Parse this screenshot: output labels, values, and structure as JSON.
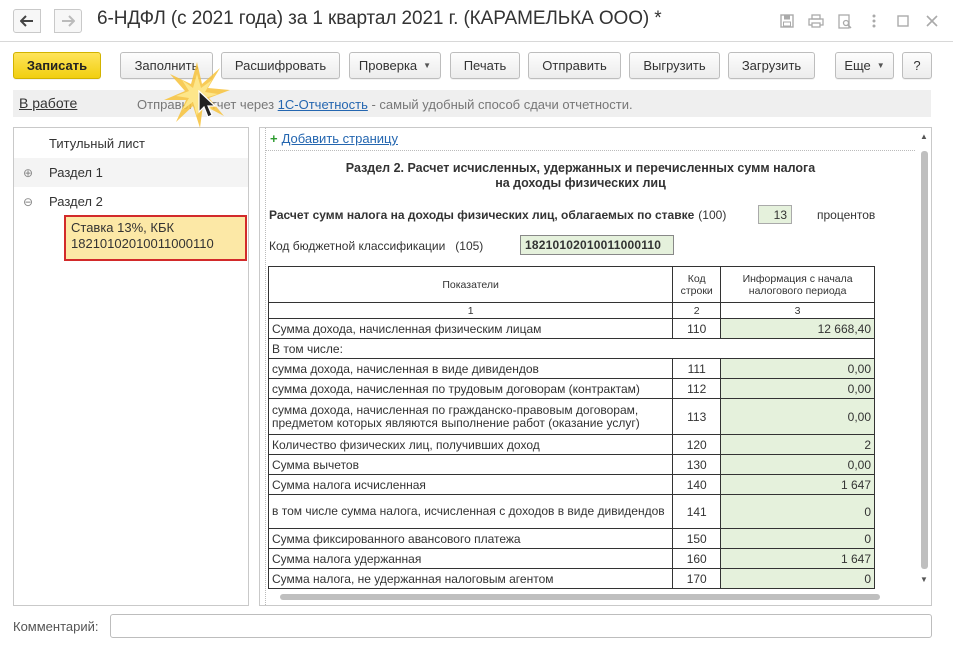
{
  "window": {
    "title": "6-НДФЛ (с 2021 года) за 1 квартал 2021 г. (КАРАМЕЛЬКА ООО) *",
    "icons": [
      "back-arrow-icon",
      "forward-arrow-icon",
      "save-disk-icon",
      "print-icon",
      "preview-icon",
      "more-vertical-icon",
      "maximize-icon",
      "close-icon"
    ]
  },
  "toolbar": {
    "save": "Записать",
    "fill": "Заполнить",
    "decode": "Расшифровать",
    "check": "Проверка",
    "print": "Печать",
    "send": "Отправить",
    "export": "Выгрузить",
    "import": "Загрузить",
    "more": "Еще",
    "help": "?"
  },
  "status": {
    "state_link": "В работе",
    "info_prefix": "Отправьте отчет через ",
    "info_link": "1С-Отчетность",
    "info_suffix": " - самый удобный способ сдачи отчетности."
  },
  "tree": {
    "items": [
      {
        "label": "Титульный лист",
        "toggle": ""
      },
      {
        "label": "Раздел 1",
        "toggle": "⊕"
      },
      {
        "label": "Раздел 2",
        "toggle": "⊖"
      }
    ],
    "selected_line1": "Ставка 13%, КБК",
    "selected_line2": "18210102010011000110"
  },
  "form": {
    "add_page": "Добавить страницу",
    "section_title_line1": "Раздел 2. Расчет исчисленных, удержанных и перечисленных сумм налога",
    "section_title_line2": "на доходы физических лиц",
    "rate_label": "Расчет сумм налога на доходы физических лиц, облагаемых по ставке",
    "rate_code": "(100)",
    "rate_value": "13",
    "rate_unit": "процентов",
    "kbk_label": "Код бюджетной классификации   (105)",
    "kbk_value": "18210102010011000110",
    "table": {
      "headers": [
        "Показатели",
        "Код\nстроки",
        "Информация с начала\nналогового периода"
      ],
      "col_numbers": [
        "1",
        "2",
        "3"
      ],
      "rows": [
        {
          "label": "Сумма дохода, начисленная физическим лицам",
          "code": "110",
          "value": "12 668,40"
        },
        {
          "label": "В том числе:",
          "code": "",
          "value": ""
        },
        {
          "label": "сумма дохода, начисленная в виде дивидендов",
          "code": "111",
          "value": "0,00"
        },
        {
          "label": "сумма дохода, начисленная по трудовым договорам (контрактам)",
          "code": "112",
          "value": "0,00"
        },
        {
          "label": "сумма дохода, начисленная по гражданско-правовым договорам, предметом которых являются выполнение работ (оказание услуг)",
          "code": "113",
          "value": "0,00"
        },
        {
          "label": "Количество физических лиц, получивших доход",
          "code": "120",
          "value": "2"
        },
        {
          "label": "Сумма вычетов",
          "code": "130",
          "value": "0,00"
        },
        {
          "label": "Сумма налога исчисленная",
          "code": "140",
          "value": "1 647"
        },
        {
          "label": "в том числе сумма налога, исчисленная с доходов в виде дивидендов",
          "code": "141",
          "value": "0"
        },
        {
          "label": "Сумма фиксированного авансового платежа",
          "code": "150",
          "value": "0"
        },
        {
          "label": "Сумма налога удержанная",
          "code": "160",
          "value": "1 647"
        },
        {
          "label": "Сумма налога, не удержанная налоговым агентом",
          "code": "170",
          "value": "0"
        }
      ]
    }
  },
  "comment": {
    "label": "Комментарий:",
    "value": ""
  },
  "colors": {
    "primary_button": "#f1cf10",
    "input_fill": "#e5f1dc",
    "selection_fill": "#fce8a6",
    "selection_border": "#d22a2a",
    "link": "#2466b0"
  }
}
